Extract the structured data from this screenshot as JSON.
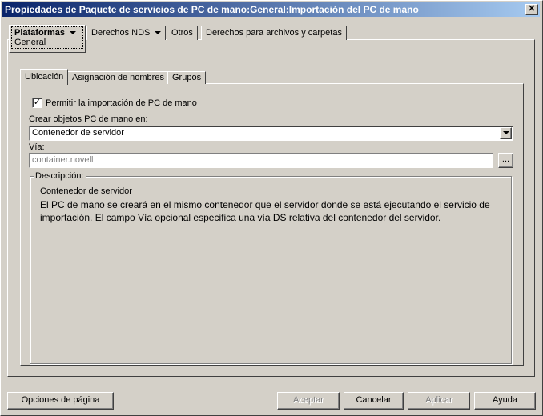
{
  "window": {
    "title": "Propiedades de Paquete de servicios de PC de mano:General:Importación del PC  de mano",
    "close_label": "✕"
  },
  "outer_tabs": [
    {
      "label": "Plataformas",
      "sub": "General"
    },
    {
      "label": "Derechos NDS"
    },
    {
      "label": "Otros"
    },
    {
      "label": "Derechos para archivos y carpetas"
    }
  ],
  "inner_tabs": [
    {
      "label": "Ubicación"
    },
    {
      "label": "Asignación de nombres"
    },
    {
      "label": "Grupos"
    }
  ],
  "form": {
    "checkbox_label": "Permitir la importación de PC de mano",
    "checkbox_checked": true,
    "create_label": "Crear objetos PC de mano en:",
    "create_value": "Contenedor de servidor",
    "path_label": "Vía:",
    "path_value": "container.novell",
    "browse_label": "...",
    "description_legend": "Descripción:",
    "description_title": "Contenedor de servidor",
    "description_text": "El PC de mano se creará en el mismo contenedor que el servidor donde se está ejecutando el servicio de importación. El campo Vía opcional especifica una vía DS relativa del contenedor del servidor."
  },
  "buttons": {
    "page_options": "Opciones de página",
    "ok": "Aceptar",
    "cancel": "Cancelar",
    "apply": "Aplicar",
    "help": "Ayuda"
  }
}
